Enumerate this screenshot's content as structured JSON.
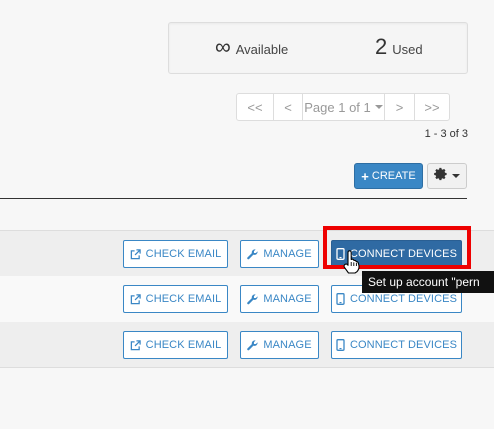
{
  "stats": {
    "available": {
      "value": "∞",
      "label": "Available"
    },
    "used": {
      "value": "2",
      "label": "Used"
    }
  },
  "pagination": {
    "first": "<<",
    "prev": "<",
    "current": "Page 1 of 1",
    "next": ">",
    "last": ">>",
    "range": "1 - 3 of 3"
  },
  "toolbar": {
    "create_label": "CREATE",
    "settings_icon": "gear-icon"
  },
  "rows": [
    {
      "check_email": "CHECK EMAIL",
      "manage": "MANAGE",
      "connect": "CONNECT DEVICES"
    },
    {
      "check_email": "CHECK EMAIL",
      "manage": "MANAGE",
      "connect": "CONNECT DEVICES"
    },
    {
      "check_email": "CHECK EMAIL",
      "manage": "MANAGE",
      "connect": "CONNECT DEVICES"
    }
  ],
  "tooltip": "Set up account \"pern",
  "colors": {
    "primary": "#3a87c5",
    "primary_dark": "#2f6aa3",
    "highlight": "#ee0000"
  }
}
